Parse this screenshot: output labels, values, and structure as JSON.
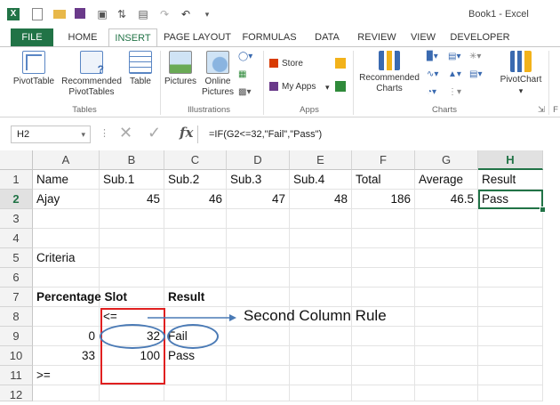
{
  "window": {
    "title": "Book1 - Excel"
  },
  "tabs": [
    "FILE",
    "HOME",
    "INSERT",
    "PAGE LAYOUT",
    "FORMULAS",
    "DATA",
    "REVIEW",
    "VIEW",
    "DEVELOPER"
  ],
  "ribbon": {
    "tables": {
      "pivot": "PivotTable",
      "recommended_l1": "Recommended",
      "recommended_l2": "PivotTables",
      "table": "Table",
      "group": "Tables"
    },
    "illustrations": {
      "pictures": "Pictures",
      "online_l1": "Online",
      "online_l2": "Pictures",
      "group": "Illustrations"
    },
    "apps": {
      "store": "Store",
      "myapps": "My Apps",
      "group": "Apps"
    },
    "charts": {
      "rec_l1": "Recommended",
      "rec_l2": "Charts",
      "group": "Charts",
      "pivotchart": "PivotChart",
      "group_trunc": "F"
    }
  },
  "formula_bar": {
    "name_box": "H2",
    "fx": "fx",
    "formula": "=IF(G2<=32,\"Fail\",\"Pass\")"
  },
  "columns": [
    "A",
    "B",
    "C",
    "D",
    "E",
    "F",
    "G",
    "H"
  ],
  "rows": [
    "1",
    "2",
    "3",
    "4",
    "5",
    "6",
    "7",
    "8",
    "9",
    "10",
    "11",
    "12"
  ],
  "cells": {
    "A1": "Name",
    "B1": "Sub.1",
    "C1": "Sub.2",
    "D1": "Sub.3",
    "E1": "Sub.4",
    "F1": "Total",
    "G1": "Average",
    "H1": "Result",
    "A2": "Ajay",
    "B2": "45",
    "C2": "46",
    "D2": "47",
    "E2": "48",
    "F2": "186",
    "G2": "46.5",
    "H2": "Pass",
    "A5": "Criteria",
    "A7": "Percentage Slot",
    "C7": "Result",
    "B8": "<=",
    "A9": "0",
    "B9": "32",
    "C9": "Fail",
    "A10": "33",
    "B10": "100",
    "C10": "Pass",
    "A11": ">="
  },
  "annotation": {
    "text": "Second Column Rule",
    "color": "#4a7ab5",
    "box_color": "#e02020"
  },
  "colors": {
    "excel_green": "#217346"
  }
}
